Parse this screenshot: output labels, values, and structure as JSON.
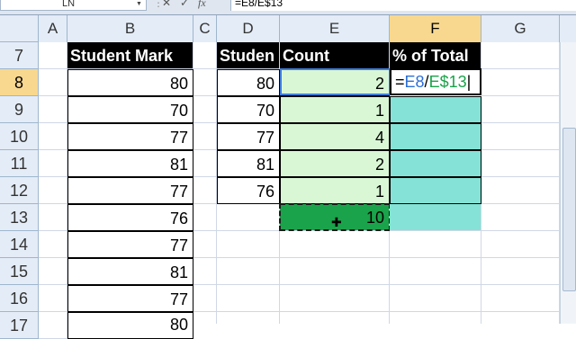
{
  "formula_bar": {
    "name_box": "LN",
    "cancel_symbol": "✕",
    "enter_symbol": "✓",
    "fx_symbol": "fx",
    "formula": "=E8/E$13"
  },
  "columns": [
    "A",
    "B",
    "C",
    "D",
    "E",
    "F",
    "G"
  ],
  "rows": [
    "7",
    "8",
    "9",
    "10",
    "11",
    "12",
    "13",
    "14",
    "15",
    "16",
    "17"
  ],
  "headers": {
    "b7": "Student Mark",
    "d7": "Studen",
    "e7": "Count",
    "f7": "% of Total"
  },
  "column_b": [
    "80",
    "70",
    "77",
    "81",
    "77",
    "76",
    "77",
    "81",
    "77",
    "80"
  ],
  "column_d": [
    "80",
    "70",
    "77",
    "81",
    "76"
  ],
  "column_e": [
    "2",
    "1",
    "4",
    "2",
    "1"
  ],
  "e13_total": "10",
  "f8_formula_parts": [
    "=",
    "E8",
    "/",
    "E$13"
  ]
}
